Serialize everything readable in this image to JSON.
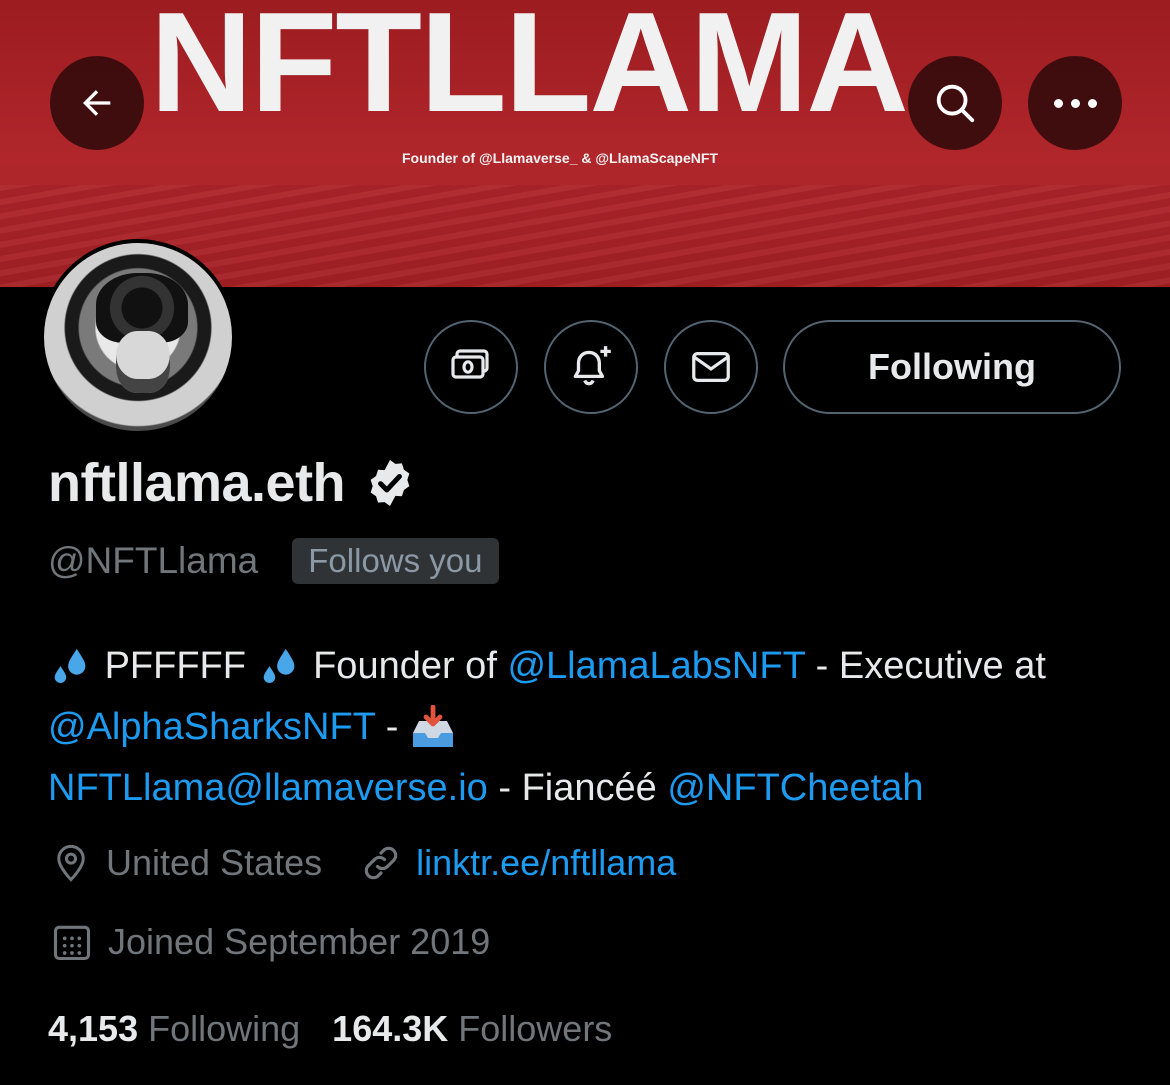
{
  "banner": {
    "title": "NFTLLAMA",
    "subtitle": "Founder of @Llamaverse_ & @LlamaScapeNFT",
    "color": "#a8222a"
  },
  "nav": {
    "back_icon": "back-arrow-icon",
    "search_icon": "search-icon",
    "more_icon": "more-dots-icon"
  },
  "actions": {
    "tip_icon": "tip-money-icon",
    "notify_icon": "bell-plus-icon",
    "message_icon": "envelope-icon",
    "follow_label": "Following"
  },
  "profile": {
    "display_name": "nftllama.eth",
    "verified_icon": "verified-badge-icon",
    "handle": "@NFTLlama",
    "follows_you": "Follows you"
  },
  "bio": {
    "p1": "PFFFFF",
    "p2": "Founder of",
    "m1": "@LlamaLabsNFT",
    "p3": "-",
    "p4": "Executive at",
    "m2": "@AlphaSharksNFT",
    "p5": "-",
    "email": "NFTLlama@llamaverse.io",
    "p6": "- Fiancéé",
    "m3": "@NFTCheetah"
  },
  "meta": {
    "location": "United States",
    "location_icon": "location-pin-icon",
    "website": "linktr.ee/nftllama",
    "link_icon": "link-icon",
    "joined": "Joined September 2019",
    "calendar_icon": "calendar-icon"
  },
  "stats": {
    "following_count": "4,153",
    "following_label": "Following",
    "followers_count": "164.3K",
    "followers_label": "Followers"
  },
  "colors": {
    "accent": "#1d9bf0",
    "muted": "#71767b",
    "border": "#536471"
  }
}
